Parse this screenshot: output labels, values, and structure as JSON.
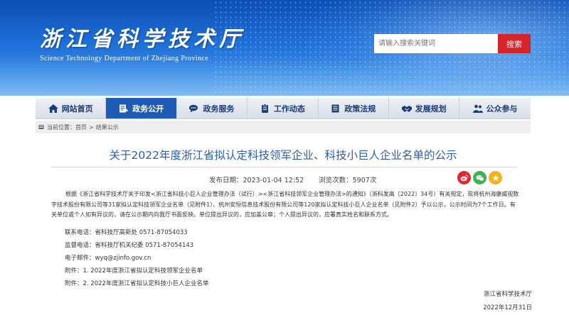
{
  "header": {
    "logo_cn": "浙江省科学技术厅",
    "logo_en": "Science Technology Department of Zhejiang Province",
    "search_placeholder": "请输入搜索关键词",
    "search_button": "搜索"
  },
  "nav": [
    {
      "label": "网站首页",
      "icon": "home-icon",
      "active": false
    },
    {
      "label": "政务公开",
      "icon": "document-icon",
      "active": true
    },
    {
      "label": "政务服务",
      "icon": "chat-icon",
      "active": false
    },
    {
      "label": "工作动态",
      "icon": "clipboard-icon",
      "active": false
    },
    {
      "label": "政策法规",
      "icon": "book-icon",
      "active": false
    },
    {
      "label": "发展规划",
      "icon": "handshake-icon",
      "active": false
    },
    {
      "label": "公众参与",
      "icon": "people-icon",
      "active": false
    }
  ],
  "breadcrumb": {
    "prefix": "当前位置：",
    "home": "首页",
    "sep": ">",
    "current": "结果公示"
  },
  "article": {
    "title": "关于2022年度浙江省拟认定科技领军企业、科技小巨人企业名单的公示",
    "publish_time": "发布日期：2023-01-04 12:52",
    "views": "浏览次数：5907次",
    "paragraph": "根据《浙江省科学技术厅关于印发<浙江省科技小巨人企业管理办法（试行）><浙江省科技领军企业管理办法>的通知》（浙科发高〔2022〕34号）有关规定，现将杭州海康威视数字技术股份有限公司等31家拟认定科技领军企业名单（见附件1）、杭州安恒信息技术股份有限公司等120家拟认定科技小巨人企业名单（见附件2）予以公示，公示时间为7个工作日。有关单位或个人如有异议的，请在公示期内向我厅书面反映。单位提出异议的，应加盖公章；个人提出异议的，应署真实姓名和联系方式。",
    "contact": "联系电话：省科技厅高新处  0571-87054033",
    "supervise": "监督电话：省科技厅机关纪委  0571-87054143",
    "email": "电子邮件：wyq@zjinfo.gov.cn",
    "attachment1": "附件：1. 2022年度浙江省拟认定科技领军企业名单",
    "attachment2": "附件：2. 2022年度浙江省拟认定科技小巨人企业名单",
    "signature": "浙江省科学技术厅",
    "sign_date": "2022年12月31日"
  },
  "share": [
    "weibo-icon",
    "wechat-icon",
    "star-icon"
  ],
  "colors": {
    "accent": "#1e5bb5",
    "search_button": "#d6232a",
    "title": "#2a5fb0"
  }
}
